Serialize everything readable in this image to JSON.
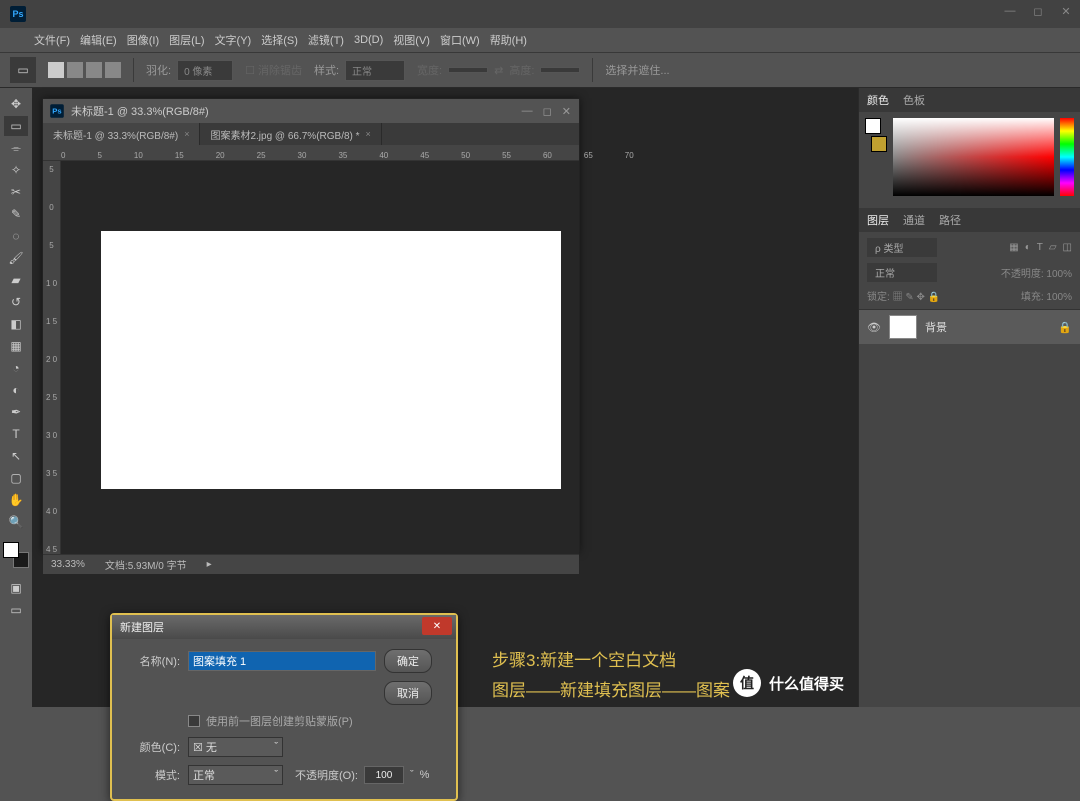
{
  "menu": [
    "文件(F)",
    "编辑(E)",
    "图像(I)",
    "图层(L)",
    "文字(Y)",
    "选择(S)",
    "滤镜(T)",
    "3D(D)",
    "视图(V)",
    "窗口(W)",
    "帮助(H)"
  ],
  "options_bar": {
    "feather_label": "羽化:",
    "feather_value": "0 像素",
    "antialias": "消除锯齿",
    "style_label": "样式:",
    "style_value": "正常",
    "width_label": "宽度:",
    "height_label": "高度:",
    "refine": "选择并遮住..."
  },
  "document": {
    "window_title": "未标题-1 @ 33.3%(RGB/8#)",
    "tabs": [
      {
        "label": "未标题-1 @ 33.3%(RGB/8#)",
        "close": "×"
      },
      {
        "label": "图案素材2.jpg @ 66.7%(RGB/8) *",
        "close": "×"
      }
    ],
    "ruler_h": [
      "0",
      "5",
      "10",
      "15",
      "20",
      "25",
      "30",
      "35",
      "40",
      "45",
      "50",
      "55",
      "60",
      "65",
      "70"
    ],
    "ruler_v": [
      "5",
      "0",
      "5",
      "1\n0",
      "1\n5",
      "2\n0",
      "2\n5",
      "3\n0",
      "3\n5",
      "4\n0",
      "4\n5"
    ],
    "zoom": "33.33%",
    "doc_info": "文档:5.93M/0 字节"
  },
  "dialog": {
    "title": "新建图层",
    "name_label": "名称(N):",
    "name_value": "图案填充 1",
    "clip_label": "使用前一图层创建剪贴蒙版(P)",
    "color_label": "颜色(C):",
    "color_value": "无",
    "mode_label": "模式:",
    "mode_value": "正常",
    "opacity_label": "不透明度(O):",
    "opacity_value": "100",
    "opacity_unit": "%",
    "ok": "确定",
    "cancel": "取消"
  },
  "annotation": {
    "line1": "步骤3:新建一个空白文档",
    "line2": "图层——新建填充图层——图案"
  },
  "right": {
    "color_tab": "颜色",
    "swatch_tab": "色板",
    "layers_tab": "图层",
    "channels_tab": "通道",
    "paths_tab": "路径",
    "kind": "ρ 类型",
    "blend": "正常",
    "opacity_label": "不透明度:",
    "opacity": "100%",
    "lock_label": "锁定:",
    "fill_label": "填充:",
    "fill": "100%",
    "layer_name": "背景"
  },
  "watermark": "什么值得买",
  "watermark_badge": "值"
}
